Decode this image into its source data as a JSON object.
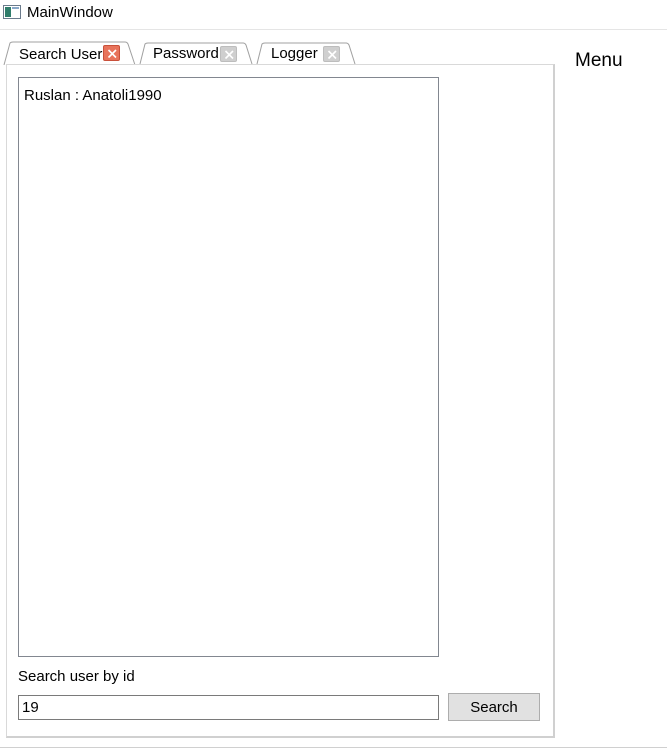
{
  "window": {
    "title": "MainWindow",
    "icon": "window-app-icon"
  },
  "tabs": [
    {
      "label": "Search User",
      "active": true,
      "close_icon": "close-icon"
    },
    {
      "label": "Password",
      "active": false,
      "close_icon": "close-icon"
    },
    {
      "label": "Logger",
      "active": false,
      "close_icon": "close-icon"
    }
  ],
  "search_user": {
    "results": [
      "Ruslan : Anatoli1990"
    ],
    "label": "Search user by id",
    "input_value": "19",
    "button_label": "Search"
  },
  "menu": {
    "label": "Menu"
  },
  "colors": {
    "active_close_bg": "#e8735b",
    "inactive_close_bg": "#cfcfcf",
    "button_bg": "#e1e1e1"
  }
}
